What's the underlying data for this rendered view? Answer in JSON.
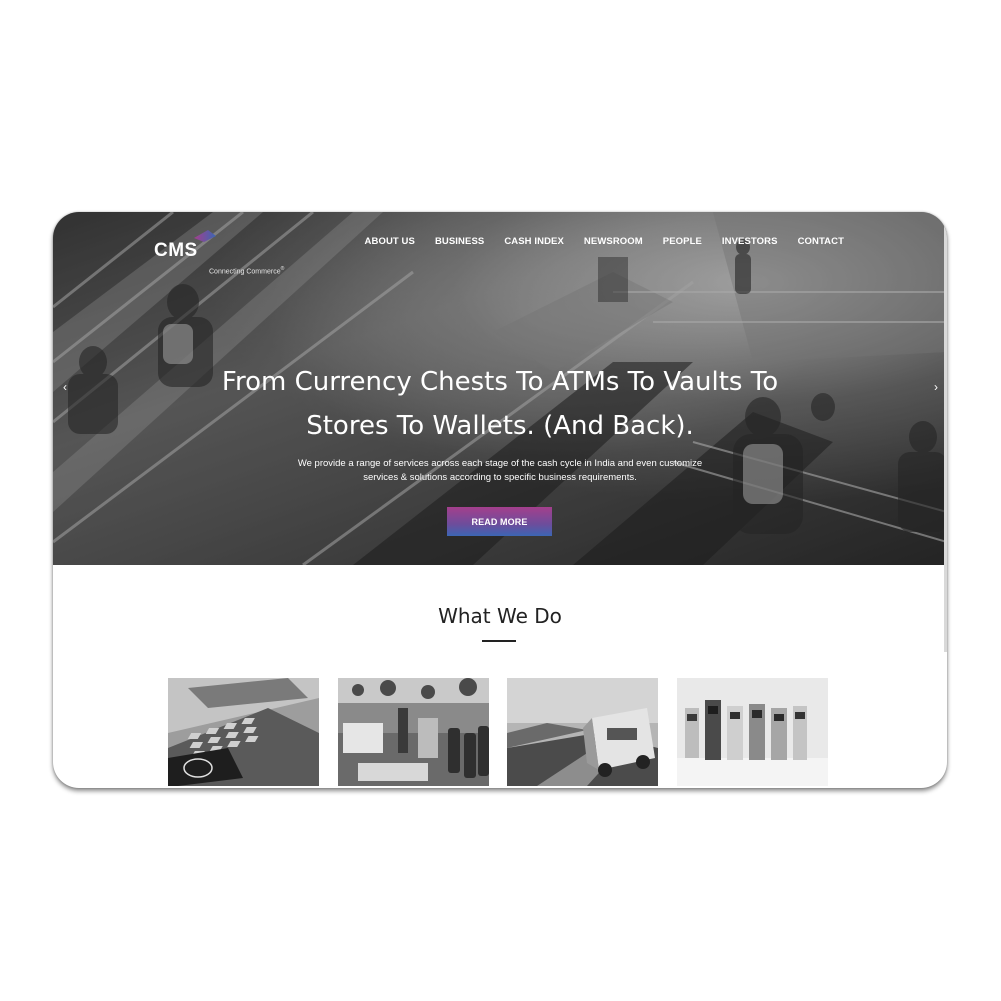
{
  "brand": {
    "name": "CMS",
    "tagline": "Connecting Commerce",
    "trademark": "®",
    "accent_colors": [
      "#a43f8c",
      "#3c66b4"
    ]
  },
  "nav": {
    "items": [
      "ABOUT US",
      "BUSINESS",
      "CASH INDEX",
      "NEWSROOM",
      "PEOPLE",
      "INVESTORS",
      "CONTACT"
    ]
  },
  "hero": {
    "headline_line1": "From Currency Chests To ATMs To Vaults To",
    "headline_line2": "Stores To Wallets. (And Back).",
    "subtext_line1": "We provide a range of services across each stage of the cash cycle in India and even customize",
    "subtext_line2": "services & solutions according to specific business requirements.",
    "cta_label": "READ MORE",
    "prev_arrow": "‹",
    "next_arrow": "›"
  },
  "section": {
    "title": "What We Do"
  },
  "cards": [
    {
      "icon": "atm-keypad-image"
    },
    {
      "icon": "retail-store-image"
    },
    {
      "icon": "cash-van-image"
    },
    {
      "icon": "atm-machines-image"
    }
  ]
}
